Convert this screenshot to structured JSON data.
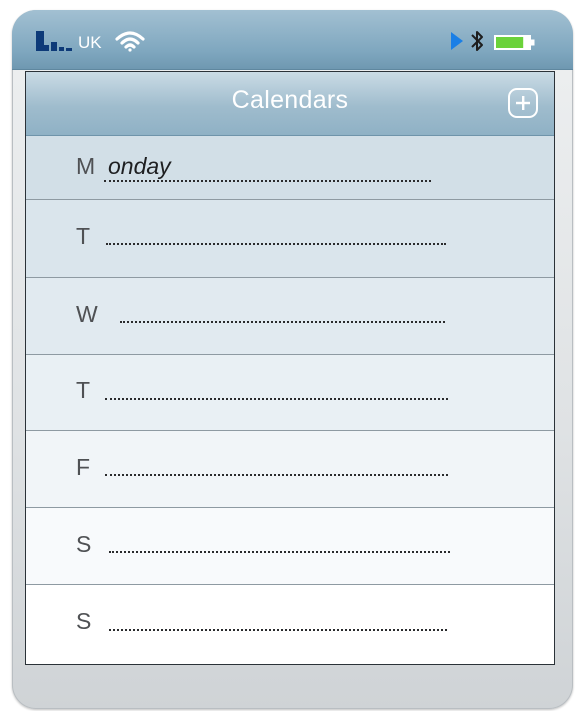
{
  "status_bar": {
    "carrier": "UK",
    "icons": [
      "signal-bars-icon",
      "wifi-icon",
      "play-icon",
      "bluetooth-icon",
      "battery-icon"
    ],
    "battery_level": 0.8
  },
  "nav_bar": {
    "title": "Calendars",
    "add_icon": "plus-icon"
  },
  "days": [
    {
      "letter": "M",
      "entry": "onday"
    },
    {
      "letter": "T",
      "entry": ""
    },
    {
      "letter": "W",
      "entry": ""
    },
    {
      "letter": "T",
      "entry": ""
    },
    {
      "letter": "F",
      "entry": ""
    },
    {
      "letter": "S",
      "entry": ""
    },
    {
      "letter": "S",
      "entry": ""
    }
  ],
  "colors": {
    "status_bar": "#7fa7bf",
    "nav_bar": "#9fbccd",
    "battery_fill": "#6bd23a",
    "text": "#4f5154"
  }
}
